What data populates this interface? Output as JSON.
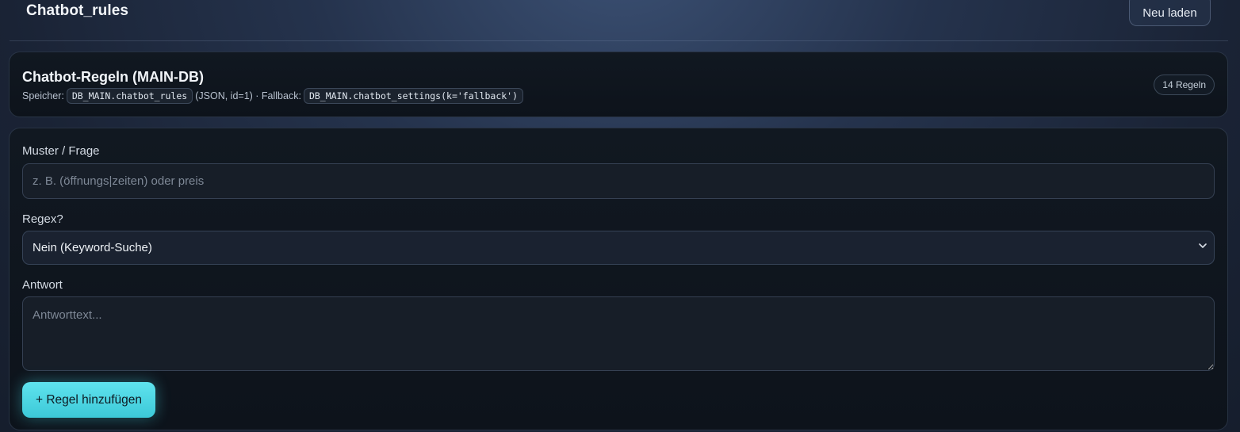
{
  "header": {
    "title": "Chatbot_rules",
    "reload_label": "Neu laden"
  },
  "info": {
    "title": "Chatbot-Regeln (MAIN-DB)",
    "storage_prefix": "Speicher:",
    "storage_code": "DB_MAIN.chatbot_rules",
    "storage_suffix": "(JSON, id=1) · Fallback:",
    "fallback_code": "DB_MAIN.chatbot_settings(k='fallback')",
    "count_badge": "14 Regeln"
  },
  "form": {
    "pattern_label": "Muster / Frage",
    "pattern_placeholder": "z. B. (öffnungs|zeiten) oder preis",
    "pattern_value": "",
    "regex_label": "Regex?",
    "regex_selected": "Nein (Keyword-Suche)",
    "answer_label": "Antwort",
    "answer_placeholder": "Antworttext...",
    "answer_value": "",
    "add_label": "+ Regel hinzufügen"
  },
  "icons": {
    "select_chevron": "chevron-down-icon",
    "textarea_grip": "resize-grip-icon"
  },
  "colors": {
    "accent": "#4fd6e3",
    "card_bg": "#0f151d"
  }
}
